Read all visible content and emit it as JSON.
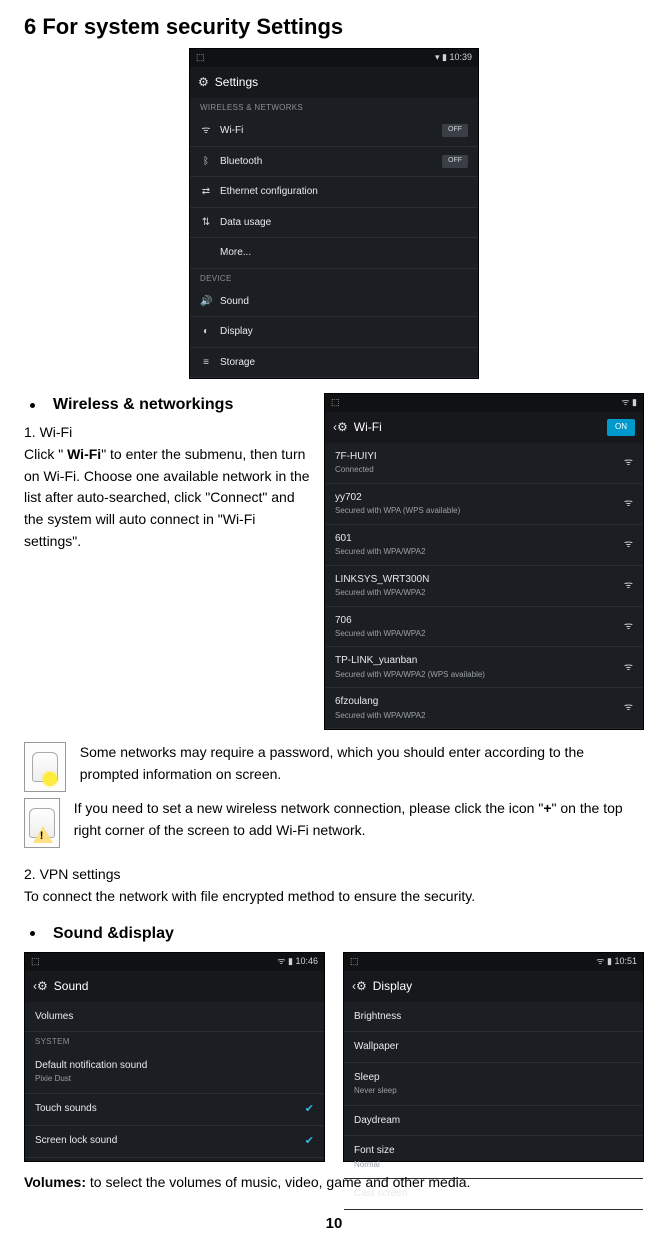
{
  "page_title": "6 For system security Settings",
  "page_number": "10",
  "settings_shot": {
    "time": "10:39",
    "header": "Settings",
    "section_wireless": "WIRELESS & NETWORKS",
    "items_wireless": [
      {
        "icon": "wifi",
        "label": "Wi-Fi",
        "toggle": "OFF"
      },
      {
        "icon": "bluetooth",
        "label": "Bluetooth",
        "toggle": "OFF"
      },
      {
        "icon": "ethernet",
        "label": "Ethernet configuration"
      },
      {
        "icon": "data",
        "label": "Data usage"
      },
      {
        "icon": "none",
        "label": "More..."
      }
    ],
    "section_device": "DEVICE",
    "items_device": [
      {
        "icon": "sound",
        "label": "Sound"
      },
      {
        "icon": "display",
        "label": "Display"
      },
      {
        "icon": "storage",
        "label": "Storage"
      }
    ]
  },
  "wireless_heading": "Wireless & networkings",
  "wifi_sub_heading": "1. Wi-Fi",
  "wifi_para_pre": "Click \" ",
  "wifi_para_bold": "Wi-Fi",
  "wifi_para_post": "\" to enter the submenu, then turn on Wi-Fi. Choose one available network in the list after auto-searched, click \"Connect\" and the system will auto connect in \"Wi-Fi settings\".",
  "wifi_shot": {
    "time": "",
    "header": "Wi-Fi",
    "toggle": "ON",
    "networks": [
      {
        "name": "7F-HUIYI",
        "sub": "Connected"
      },
      {
        "name": "yy702",
        "sub": "Secured with WPA (WPS available)"
      },
      {
        "name": "601",
        "sub": "Secured with WPA/WPA2"
      },
      {
        "name": "LINKSYS_WRT300N",
        "sub": "Secured with WPA/WPA2"
      },
      {
        "name": "706",
        "sub": "Secured with WPA/WPA2"
      },
      {
        "name": "TP-LINK_yuanban",
        "sub": "Secured with WPA/WPA2 (WPS available)"
      },
      {
        "name": "6fzoulang",
        "sub": "Secured with WPA/WPA2"
      }
    ]
  },
  "note_bulb": "Some networks may require a password, which you should enter according to the prompted information on screen.",
  "note_warn_pre": "If you need to set a new wireless network connection, please click the icon \"",
  "note_warn_bold": "+",
  "note_warn_post": "\" on the top right corner of the screen to add Wi-Fi network.",
  "vpn_heading": "2. VPN settings",
  "vpn_text": "To connect the network with file encrypted method to ensure the security.",
  "sound_heading": "Sound &display",
  "sound_shot": {
    "time": "10:46",
    "header": "Sound",
    "volumes": "Volumes",
    "section": "SYSTEM",
    "items": [
      {
        "label": "Default notification sound",
        "sub": "Pixie Dust",
        "checked": false
      },
      {
        "label": "Touch sounds",
        "checked": true
      },
      {
        "label": "Screen lock sound",
        "checked": true
      }
    ]
  },
  "display_shot": {
    "time": "10:51",
    "header": "Display",
    "items": [
      {
        "label": "Brightness"
      },
      {
        "label": "Wallpaper"
      },
      {
        "label": "Sleep",
        "sub": "Never sleep"
      },
      {
        "label": "Daydream"
      },
      {
        "label": "Font size",
        "sub": "Normal"
      },
      {
        "label": "Cast screen"
      }
    ]
  },
  "volumes_label": "Volumes:",
  "volumes_text": " to select the volumes of music, video, game and other media."
}
